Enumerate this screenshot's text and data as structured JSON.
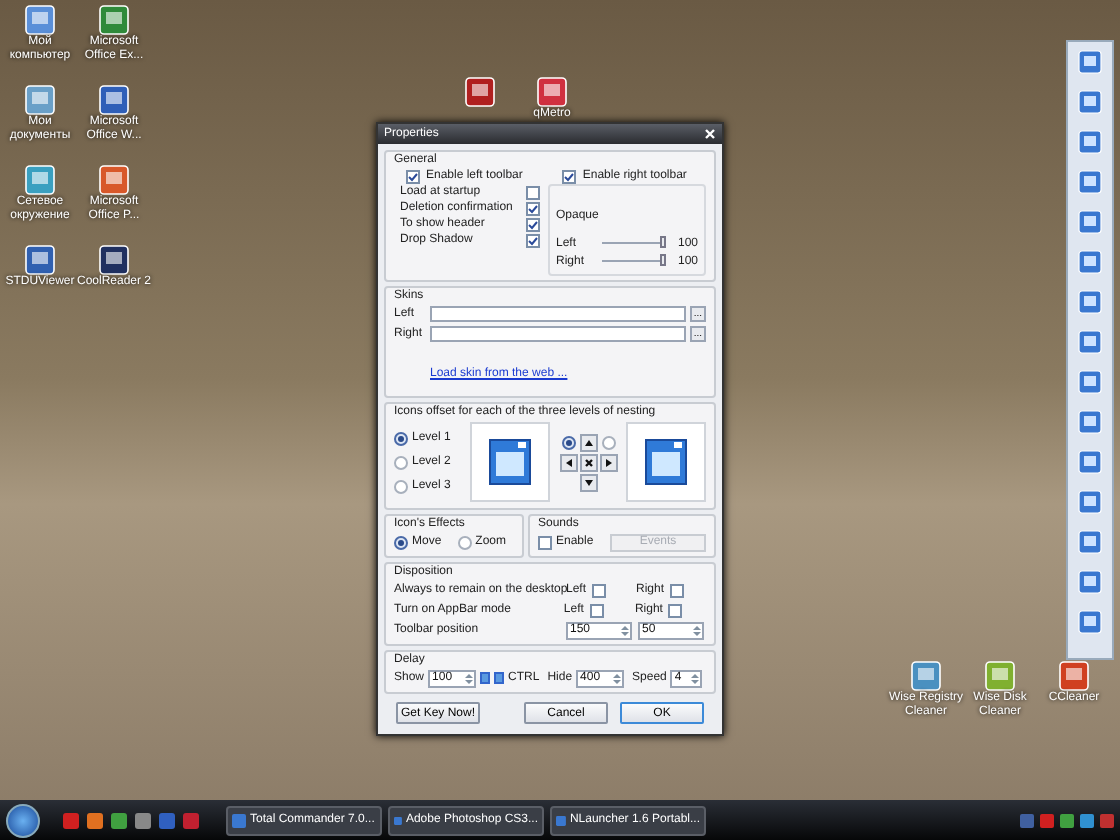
{
  "desktop_icons": [
    {
      "label": "Мой компьютер",
      "color": "#5a8fd8"
    },
    {
      "label": "Microsoft Office Ex...",
      "color": "#2f8a3a"
    },
    {
      "label": "Мои документы",
      "color": "#6aa0c8"
    },
    {
      "label": "Microsoft Office W...",
      "color": "#2f5fb8"
    },
    {
      "label": "Сетевое окружение",
      "color": "#3aa0c0"
    },
    {
      "label": "Microsoft Office P...",
      "color": "#d8582a"
    },
    {
      "label": "STDUViewer",
      "color": "#3060b0"
    },
    {
      "label": "CoolReader 2",
      "color": "#203060"
    }
  ],
  "top_icons": [
    {
      "color": "#b02020"
    },
    {
      "label": "qMetro",
      "color": "#d03040"
    }
  ],
  "corner_icons": [
    {
      "label": "Wise Registry Cleaner",
      "color": "#4a90c0"
    },
    {
      "label": "Wise Disk Cleaner",
      "color": "#80b030"
    },
    {
      "label": "CCleaner",
      "color": "#d04020"
    }
  ],
  "dialog": {
    "title": "Properties",
    "general": {
      "title": "General",
      "toolbars": [
        {
          "label": "Enable left toolbar",
          "checked": true
        },
        {
          "label": "Enable right toolbar",
          "checked": true
        }
      ],
      "options": [
        {
          "label": "Load at startup",
          "checked": false
        },
        {
          "label": "Deletion confirmation",
          "checked": true
        },
        {
          "label": "To show header",
          "checked": true
        },
        {
          "label": "Drop Shadow",
          "checked": true
        }
      ],
      "opaque": {
        "title": "Opaque",
        "sliders": [
          {
            "label": "Left",
            "level": 1,
            "reading": "100"
          },
          {
            "label": "Right",
            "level": 1,
            "reading": "100"
          }
        ]
      }
    },
    "skins": {
      "title": "Skins",
      "fields": [
        {
          "label": "Left",
          "browse": "..."
        },
        {
          "label": "Right",
          "browse": "..."
        }
      ],
      "link": "Load skin from the web ..."
    },
    "offset": {
      "title": "Icons offset for each of the three levels of nesting",
      "levels": [
        {
          "label": "Level 1",
          "selected": true
        },
        {
          "label": "Level 2",
          "selected": false
        },
        {
          "label": "Level 3",
          "selected": false
        }
      ],
      "pad_modes": [
        {
          "selected": true
        },
        {
          "selected": false
        }
      ]
    },
    "effects": {
      "title": "Icon's Effects",
      "options": [
        {
          "label": "Move",
          "selected": true
        },
        {
          "label": "Zoom",
          "selected": false
        }
      ]
    },
    "sounds": {
      "title": "Sounds",
      "enable": {
        "label": "Enable",
        "checked": false
      },
      "events": {
        "label": "Events",
        "disabled": true
      }
    },
    "disposition": {
      "title": "Disposition",
      "rows": [
        {
          "kind": "checks",
          "label": "Always to remain on the desktop",
          "checks": [
            {
              "label": "Left",
              "checked": false
            },
            {
              "label": "Right",
              "checked": false
            }
          ]
        },
        {
          "kind": "checks",
          "label": "Turn on AppBar mode",
          "checks": [
            {
              "label": "Left",
              "checked": false
            },
            {
              "label": "Right",
              "checked": false
            }
          ]
        },
        {
          "kind": "spins",
          "label": "Toolbar position",
          "values": [
            "150",
            "50"
          ]
        }
      ]
    },
    "delay": {
      "title": "Delay",
      "show": {
        "label": "Show",
        "value": "100"
      },
      "ctrl": "CTRL",
      "hide": {
        "label": "Hide",
        "value": "400"
      },
      "speed": {
        "label": "Speed",
        "value": "4"
      }
    },
    "buttons": [
      {
        "label": "Get Key Now!",
        "default": false
      },
      {
        "label": "Cancel",
        "default": false
      },
      {
        "label": "OK",
        "default": true
      }
    ]
  },
  "taskbar": {
    "tasks": [
      {
        "label": "Total Commander 7.0...",
        "selected": false
      },
      {
        "label": "Adobe Photoshop CS3...",
        "selected": false
      },
      {
        "label": "NLauncher 1.6 Portabl...",
        "selected": false
      }
    ]
  }
}
